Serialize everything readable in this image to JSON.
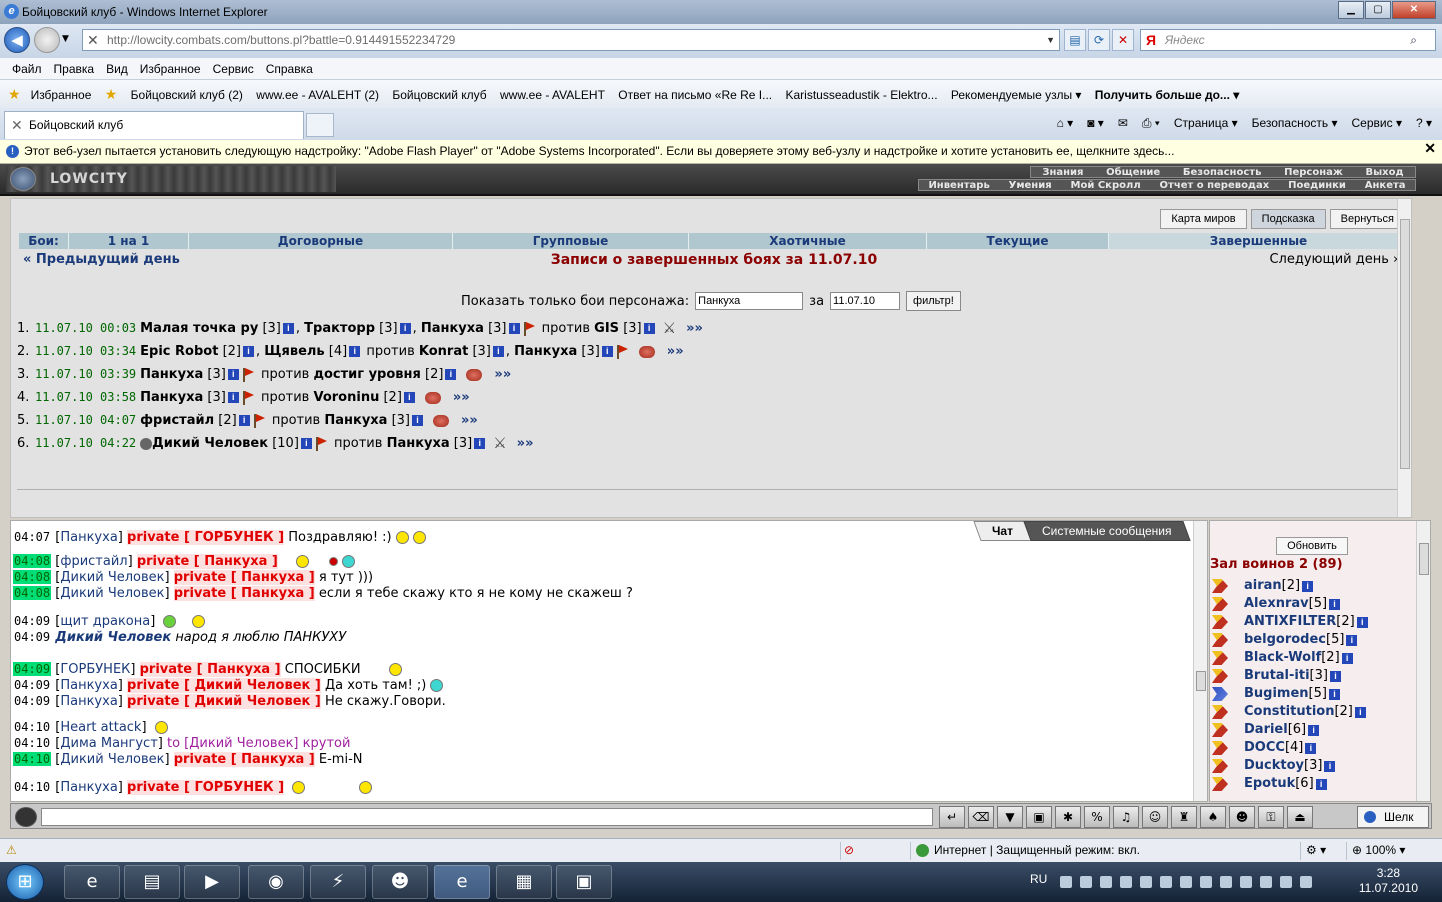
{
  "window": {
    "title": "Бойцовский клуб - Windows Internet Explorer"
  },
  "address": {
    "url": "http://lowcity.combats.com/buttons.pl?battle=0.914491552234729",
    "search_placeholder": "Яндекс"
  },
  "menu": [
    "Файл",
    "Правка",
    "Вид",
    "Избранное",
    "Сервис",
    "Справка"
  ],
  "favorites": [
    "Избранное",
    "Бойцовский клуб (2)",
    "www.ee - AVALEHT (2)",
    "Бойцовский клуб",
    "www.ee - AVALEHT",
    "Ответ на письмо «Re Re I...",
    "Karistusseadustik - Elektro...",
    "Рекомендуемые узлы ▾",
    "Получить больше до... ▾"
  ],
  "tab": {
    "label": "Бойцовский клуб"
  },
  "tab_tools": [
    "Страница ▾",
    "Безопасность ▾",
    "Сервис ▾"
  ],
  "infobar": {
    "text": "Этот веб-узел пытается установить следующую надстройку: \"Adobe Flash Player\" от \"Adobe Systems Incorporated\". Если вы доверяете этому веб-узлу и надстройке и хотите установить ее, щелкните здесь..."
  },
  "game": {
    "logo": "LOWCITY",
    "links_row1": [
      "Знания",
      "Общение",
      "Безопасность",
      "Персонаж",
      "Выход"
    ],
    "links_row2": [
      "Инвентарь",
      "Умения",
      "Мой Скролл",
      "Отчет о переводах",
      "Поединки",
      "Анкета"
    ],
    "right_buttons": [
      "Карта миров",
      "Подсказка",
      "Вернуться"
    ],
    "battle_tabs": [
      "Бои:",
      "1 на 1",
      "Договорные",
      "Групповые",
      "Хаотичные",
      "Текущие",
      "Завершенные"
    ],
    "prev_day": "« Предыдущий день",
    "title": "Записи о завершенных боях за 11.07.10",
    "next_day": "Следующий день »",
    "filter_label": "Показать только бои персонажа:",
    "filter_name": "Панкуха",
    "filter_for": "за",
    "filter_date": "11.07.10",
    "filter_button": "фильтр!",
    "battles": [
      {
        "n": "1.",
        "dt": "11.07.10 00:03",
        "a": "Малая точка ру",
        "al": "[3]",
        "a2": "Трактopp",
        "a2l": "[3]",
        "a3": "Панкуха",
        "a3l": "[3]",
        "vs": "против",
        "b": "GIS",
        "bl": "[3]",
        "more": "»»"
      },
      {
        "n": "2.",
        "dt": "11.07.10 03:34",
        "a": "Epic Robot",
        "al": "[2]",
        "a2": "Щявель",
        "a2l": "[4]",
        "vs": "против",
        "b": "Konrat",
        "bl": "[3]",
        "b2": "Панкуха",
        "b2l": "[3]",
        "more": "»»"
      },
      {
        "n": "3.",
        "dt": "11.07.10 03:39",
        "a": "Панкуха",
        "al": "[3]",
        "vs": "против",
        "b": "достиг уровня",
        "bl": "[2]",
        "more": "»»"
      },
      {
        "n": "4.",
        "dt": "11.07.10 03:58",
        "a": "Панкуха",
        "al": "[3]",
        "vs": "против",
        "b": "Voroninu",
        "bl": "[2]",
        "more": "»»"
      },
      {
        "n": "5.",
        "dt": "11.07.10 04:07",
        "a": "фристайл",
        "al": "[2]",
        "vs": "против",
        "b": "Панкуха",
        "bl": "[3]",
        "more": "»»"
      },
      {
        "n": "6.",
        "dt": "11.07.10 04:22",
        "a": "Дикий Человек",
        "al": "[10]",
        "vs": "против",
        "b": "Панкуха",
        "bl": "[3]",
        "more": "»»"
      }
    ]
  },
  "chat": {
    "tabs": [
      "Чат",
      "Системные сообщения"
    ],
    "lines": [
      {
        "t": "04:07",
        "g": false,
        "nm": "Панкуха",
        "pv": "private [ ГОРБУНЕК ]",
        "msg": "Поздравляю! :)"
      },
      {
        "t": "04:08",
        "g": true,
        "nm": "фристайл",
        "pv": "private [ Панкуха ]",
        "msg": ""
      },
      {
        "t": "04:08",
        "g": true,
        "nm": "Дикий Человек",
        "pv": "private [ Панкуха ]",
        "msg": "я тут )))"
      },
      {
        "t": "04:08",
        "g": true,
        "nm": "Дикий Человек",
        "pv": "private [ Панкуха ]",
        "msg": "если я тебе скажу кто я не кому не скажеш ?"
      },
      {
        "t": "04:09",
        "g": false,
        "nm": "щит дракона",
        "pv": "",
        "msg": ""
      },
      {
        "t": "04:09",
        "g": false,
        "it": "Дикий Человек",
        "msg": "народ я люблю ПАНКУХУ"
      },
      {
        "t": "04:09",
        "g": true,
        "nm": "ГОРБУНЕК",
        "pv": "private [ Панкуха ]",
        "msg": "СПОСИБКИ"
      },
      {
        "t": "04:09",
        "g": false,
        "nm": "Панкуха",
        "pv": "private [ Дикий Человек ]",
        "msg": "Да хоть там! ;)"
      },
      {
        "t": "04:09",
        "g": false,
        "nm": "Панкуха",
        "pv": "private [ Дикий Человек ]",
        "msg": "Не скажу.Говори."
      },
      {
        "t": "04:10",
        "g": false,
        "nm": "Heart attack",
        "pv": "",
        "msg": ""
      },
      {
        "t": "04:10",
        "g": false,
        "nm": "Дима Мангуст",
        "to": "to [Дикий Человек]",
        "tomsg": "крутой"
      },
      {
        "t": "04:10",
        "g": true,
        "nm": "Дикий Человек",
        "pv": "private [ Панкуха ]",
        "msg": "E-mi-N"
      },
      {
        "t": "04:10",
        "g": false,
        "nm": "Панкуха",
        "pv": "private [ ГОРБУНЕК ]",
        "msg": ""
      }
    ]
  },
  "sidebar": {
    "refresh": "Обновить",
    "hall": "Зал воинов 2 (89)",
    "warriors": [
      {
        "nm": "airan",
        "lv": "[2]"
      },
      {
        "nm": "Alexnrav",
        "lv": "[5]"
      },
      {
        "nm": "ANTIXFILTER",
        "lv": "[2]"
      },
      {
        "nm": "belgorodec",
        "lv": "[5]"
      },
      {
        "nm": "Black-Wolf",
        "lv": "[2]"
      },
      {
        "nm": "Brutal-iti",
        "lv": "[3]"
      },
      {
        "nm": "Bugimen",
        "lv": "[5]",
        "blue": true
      },
      {
        "nm": "Constitution",
        "lv": "[2]"
      },
      {
        "nm": "Dariel",
        "lv": "[6]"
      },
      {
        "nm": "DOCC",
        "lv": "[4]"
      },
      {
        "nm": "Ducktoy",
        "lv": "[3]"
      },
      {
        "nm": "Epotuk",
        "lv": "[6]"
      }
    ]
  },
  "toolbar": {
    "shelk": "Шелк"
  },
  "status": {
    "zone": "Интернет | Защищенный режим: вкл.",
    "zoom": "100%"
  },
  "tray": {
    "lang": "RU",
    "time": "3:28",
    "date": "11.07.2010"
  }
}
